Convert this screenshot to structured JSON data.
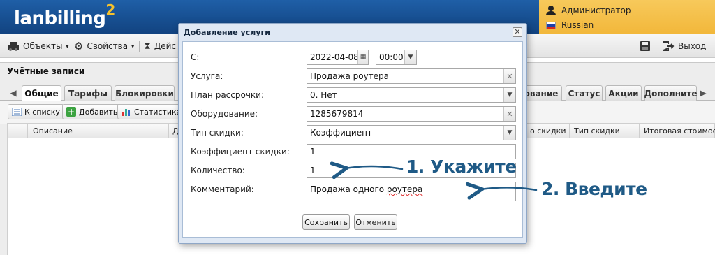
{
  "header": {
    "logo": "lanbilling",
    "logo_sup": "2",
    "user_name": "Администратор",
    "language": "Russian"
  },
  "toolbar": {
    "objects_label": "Объекты",
    "properties_label": "Свойства",
    "actions_label": "Дейс",
    "exit_label": "Выход"
  },
  "panel": {
    "title": "Учётные записи",
    "tabs": [
      "Общие",
      "Тарифы",
      "Блокировки",
      "ование",
      "Статус",
      "Акции",
      "Дополните"
    ],
    "buttons": {
      "to_list": "К списку",
      "add": "Добавить",
      "stats": "Статистика"
    },
    "columns": [
      "Описание",
      "Д",
      "о скидки",
      "Тип скидки",
      "Итоговая стоимос"
    ]
  },
  "dialog": {
    "title": "Добавление услуги",
    "fields": {
      "from_label": "С:",
      "date_value": "2022-04-08",
      "time_value": "00:00",
      "service_label": "Услуга:",
      "service_value": "Продажа роутера",
      "installment_label": "План рассрочки:",
      "installment_value": "0. Нет",
      "equipment_label": "Оборудование:",
      "equipment_value": "1285679814",
      "discount_type_label": "Тип скидки:",
      "discount_type_value": "Коэффициент",
      "discount_coef_label": "Коэффициент скидки:",
      "discount_coef_value": "1",
      "quantity_label": "Количество:",
      "quantity_value": "1",
      "comment_label": "Комментарий:",
      "comment_value_a": "Продажа одного ",
      "comment_value_b": "роутера"
    },
    "save_label": "Сохранить",
    "cancel_label": "Отменить"
  },
  "annotations": {
    "step1": "1. Укажите",
    "step2": "2. Введите"
  },
  "colors": {
    "header_blue": "#174f91",
    "user_panel_yellow": "#f2b73a",
    "annotation_blue": "#1f5a86"
  }
}
